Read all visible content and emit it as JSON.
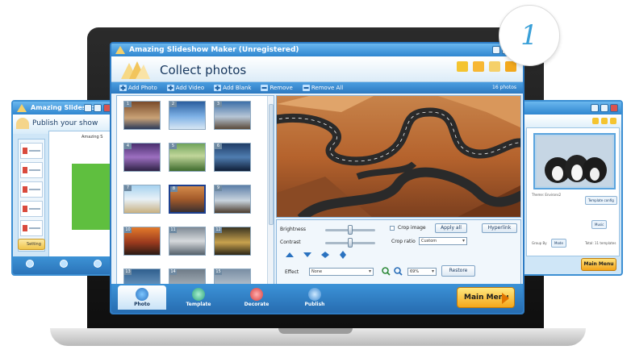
{
  "badge": "1",
  "main_window": {
    "title": "Amazing Slideshow Maker (Unregistered)",
    "header_title": "Collect photos",
    "toolbar": {
      "add_photo": "Add Photo",
      "add_video": "Add Video",
      "add_blank": "Add Blank",
      "remove": "Remove",
      "remove_all": "Remove All",
      "count": "16 photos"
    },
    "thumbnails": [
      "1",
      "2",
      "3",
      "4",
      "5",
      "6",
      "7",
      "8",
      "9",
      "10",
      "11",
      "12",
      "13",
      "14",
      "15"
    ],
    "controls": {
      "brightness_label": "Brightness",
      "contrast_label": "Contrast",
      "crop_image_label": "Crop image",
      "apply_all_label": "Apply all",
      "crop_ratio_label": "Crop ratio",
      "crop_ratio_value": "Custom",
      "hyperlink_label": "Hyperlink",
      "effect_label": "Effect",
      "effect_value": "None",
      "zoom_value": "69%",
      "restore_label": "Restore",
      "brightness_level": 0.5,
      "contrast_level": 0.5
    },
    "tabs": {
      "photo": "Photo",
      "template": "Template",
      "decorate": "Decorate",
      "publish": "Publish"
    },
    "main_menu_label": "Main Menu"
  },
  "left_window": {
    "title": "Amazing Slideshow Maker (Unregistered)",
    "header_title": "Publish your show",
    "items": [
      "Flash",
      "Flash",
      "Flash",
      "Flash",
      "Flash"
    ],
    "setting_label": "Setting",
    "preview_text": "Amazing S"
  },
  "right_window": {
    "main_menu_label": "Main Menu",
    "theme_name": "Theme: Environs2",
    "template_config": "Template config",
    "music_label": "Music",
    "group_by_label": "Group By",
    "group_by_value": "Mode",
    "total_label": "Total: 11 templates"
  },
  "colors": {
    "accent": "#2d7bc4",
    "button_orange": "#f5a71a",
    "panel_bg": "#e7f2fb"
  }
}
